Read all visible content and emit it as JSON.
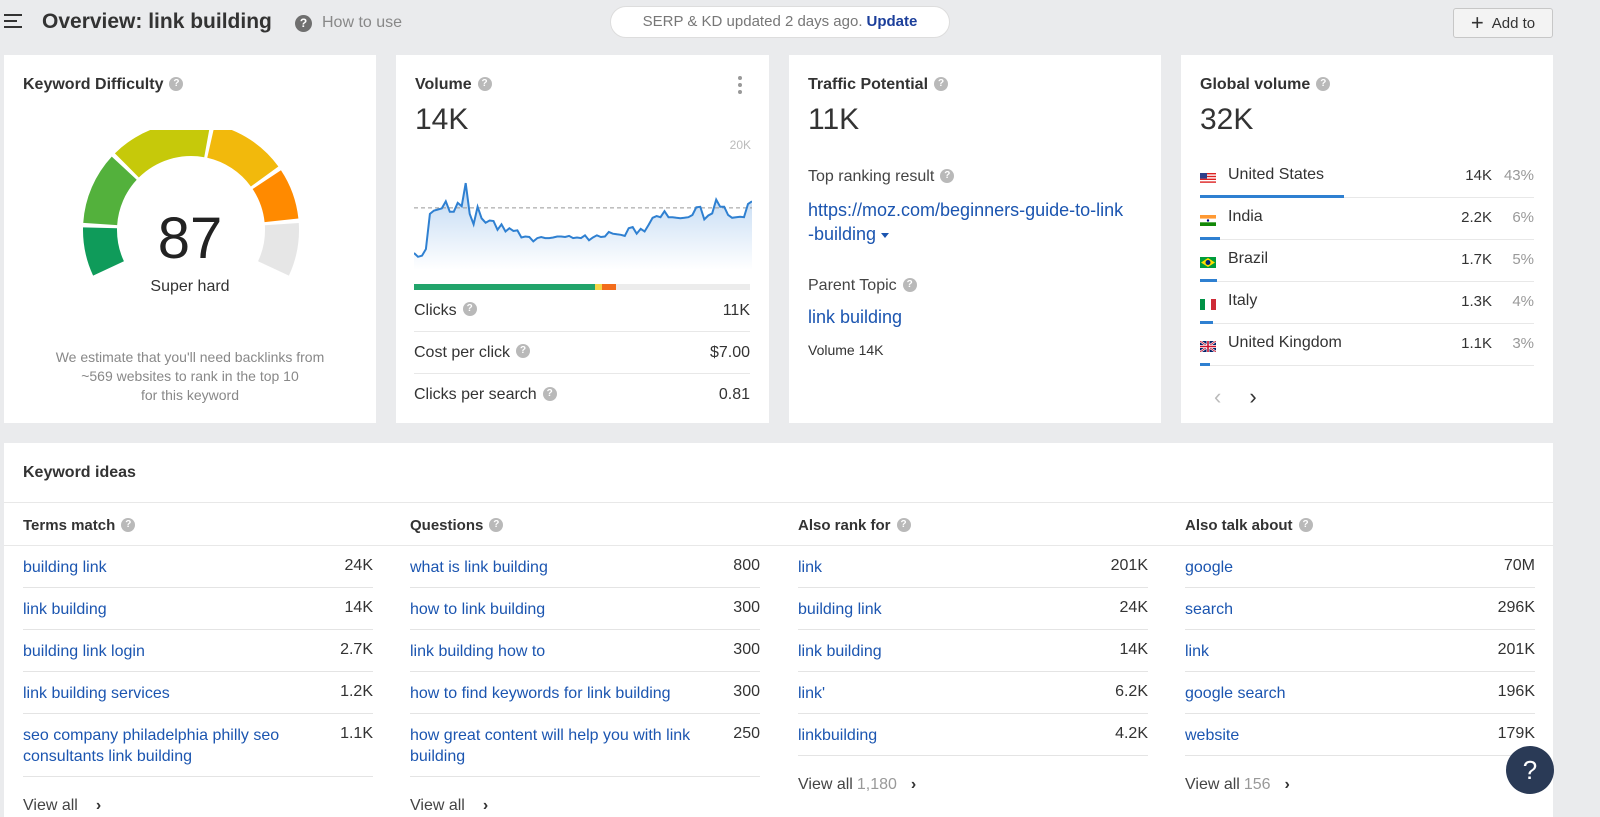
{
  "header": {
    "title": "Overview: link building",
    "how_to_use": "How to use",
    "serp_status": "SERP & KD updated 2 days ago.",
    "update_label": "Update",
    "add_to_label": "Add to"
  },
  "keyword_difficulty": {
    "title": "Keyword Difficulty",
    "value": "87",
    "score": 87,
    "label": "Super hard",
    "note_line1": "We estimate that you'll need backlinks from",
    "note_line2": "~569 websites to rank in the top 10",
    "note_line3": "for this keyword",
    "gauge_colors": [
      "#0f9b5a",
      "#53b13c",
      "#c6c90a",
      "#f2b90c",
      "#ff8a00",
      "#e6e6e6"
    ]
  },
  "volume": {
    "title": "Volume",
    "value": "14K",
    "chart_max_label": "20K",
    "trend": [
      3.1,
      2.4,
      2.6,
      3.8,
      10.2,
      10.8,
      11.0,
      11.2,
      12.5,
      10.6,
      10.6,
      12.2,
      11.6,
      15.8,
      10.2,
      8.3,
      11.5,
      9.4,
      8.6,
      9.0,
      8.9,
      7.3,
      8.3,
      7.0,
      7.6,
      7.1,
      7.2,
      5.9,
      6.1,
      6.0,
      5.2,
      5.8,
      6.0,
      5.8,
      5.8,
      5.9,
      6.1,
      6.1,
      6.0,
      6.2,
      5.8,
      5.9,
      5.8,
      6.3,
      5.4,
      5.9,
      6.3,
      6.0,
      6.1,
      6.9,
      6.6,
      6.5,
      6.4,
      6.2,
      7.6,
      7.8,
      6.6,
      7.5,
      7.0,
      8.2,
      9.5,
      9.8,
      9.6,
      10.7,
      9.6,
      9.6,
      9.5,
      9.4,
      9.5,
      9.6,
      10.0,
      11.4,
      11.5,
      9.2,
      9.9,
      10.3,
      12.8,
      11.5,
      11.5,
      10.0,
      9.5,
      9.6,
      9.7,
      9.6,
      12.0,
      12.5
    ],
    "avg_line": 11.3,
    "chart_max": 20,
    "clicks_split": {
      "organic": 0.54,
      "paid_yellow": 0.02,
      "paid_orange": 0.04
    },
    "colors": {
      "line": "#2f80d1",
      "organic": "#21a46b",
      "yellow": "#f5d547",
      "orange": "#f26c1b"
    },
    "metrics": [
      {
        "label": "Clicks",
        "value": "11K"
      },
      {
        "label": "Cost per click",
        "value": "$7.00"
      },
      {
        "label": "Clicks per search",
        "value": "0.81"
      }
    ]
  },
  "traffic_potential": {
    "title": "Traffic Potential",
    "value": "11K",
    "top_result_label": "Top ranking result",
    "top_result_url_line1": "https://moz.com/beginners-guide-to-link",
    "top_result_url_line2": "-building",
    "parent_topic_label": "Parent Topic",
    "parent_topic": "link building",
    "parent_volume": "Volume 14K"
  },
  "global_volume": {
    "title": "Global volume",
    "value": "32K",
    "countries": [
      {
        "name": "United States",
        "volume": "14K",
        "pct": "43%",
        "share": 0.43,
        "flag": "us-flag-icon"
      },
      {
        "name": "India",
        "volume": "2.2K",
        "pct": "6%",
        "share": 0.06,
        "flag": "india-flag-icon"
      },
      {
        "name": "Brazil",
        "volume": "1.7K",
        "pct": "5%",
        "share": 0.05,
        "flag": "brazil-flag-icon"
      },
      {
        "name": "Italy",
        "volume": "1.3K",
        "pct": "4%",
        "share": 0.04,
        "flag": "italy-flag-icon"
      },
      {
        "name": "United Kingdom",
        "volume": "1.1K",
        "pct": "3%",
        "share": 0.03,
        "flag": "uk-flag-icon"
      }
    ],
    "prev_glyph": "‹",
    "next_glyph": "›"
  },
  "keyword_ideas": {
    "title": "Keyword ideas",
    "columns": [
      {
        "title": "Terms match",
        "rows": [
          {
            "keyword": "building link",
            "volume": "24K"
          },
          {
            "keyword": "link building",
            "volume": "14K"
          },
          {
            "keyword": "building link login",
            "volume": "2.7K"
          },
          {
            "keyword": "link building services",
            "volume": "1.2K"
          },
          {
            "keyword": "seo company philadelphia philly seo consultants link building",
            "volume": "1.1K"
          }
        ],
        "view_all": "View all",
        "view_all_count": ""
      },
      {
        "title": "Questions",
        "rows": [
          {
            "keyword": "what is link building",
            "volume": "800"
          },
          {
            "keyword": "how to link building",
            "volume": "300"
          },
          {
            "keyword": "link building how to",
            "volume": "300"
          },
          {
            "keyword": "how to find keywords for link building",
            "volume": "300"
          },
          {
            "keyword": "how great content will help you with link building",
            "volume": "250"
          }
        ],
        "view_all": "View all",
        "view_all_count": ""
      },
      {
        "title": "Also rank for",
        "rows": [
          {
            "keyword": "link",
            "volume": "201K"
          },
          {
            "keyword": "building link",
            "volume": "24K"
          },
          {
            "keyword": "link building",
            "volume": "14K"
          },
          {
            "keyword": "link'",
            "volume": "6.2K"
          },
          {
            "keyword": "linkbuilding",
            "volume": "4.2K"
          }
        ],
        "view_all": "View all",
        "view_all_count": "1,180"
      },
      {
        "title": "Also talk about",
        "rows": [
          {
            "keyword": "google",
            "volume": "70M"
          },
          {
            "keyword": "search",
            "volume": "296K"
          },
          {
            "keyword": "link",
            "volume": "201K"
          },
          {
            "keyword": "google search",
            "volume": "196K"
          },
          {
            "keyword": "website",
            "volume": "179K"
          }
        ],
        "view_all": "View all",
        "view_all_count": "156"
      }
    ]
  },
  "help_fab": "?",
  "help_glyph": "?"
}
